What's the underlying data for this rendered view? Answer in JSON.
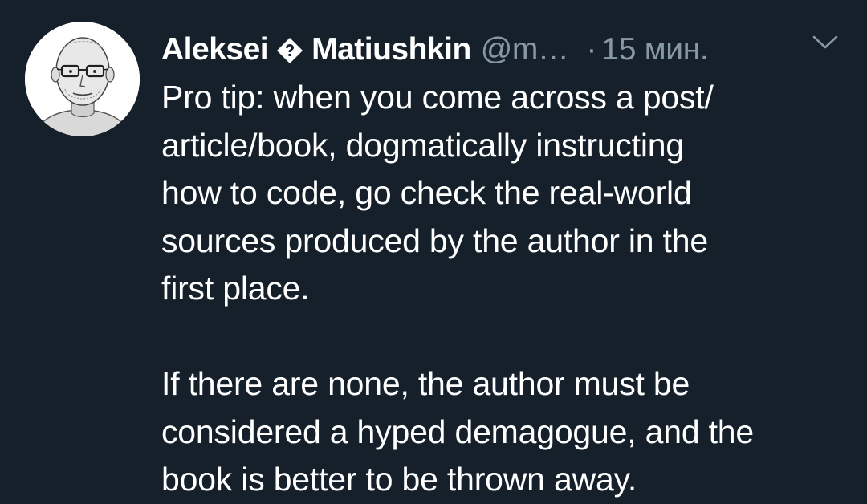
{
  "tweet": {
    "author_name_first": "Aleksei",
    "author_name_last": "Matiushkin",
    "handle": "@m…",
    "separator": "·",
    "timestamp": "15 мин.",
    "badge_icon": "verified-diamond-icon",
    "menu_icon": "chevron-down-icon",
    "text_lines": [
      "Pro tip: when you come across a post/",
      "article/book, dogmatically instructing",
      "how to code, go check the real-world",
      "sources produced by the author in the",
      "first place."
    ],
    "text_lines_2": [
      "If there are none, the author must be",
      "considered a hyped demagogue, and the",
      "book is better to be thrown away."
    ]
  },
  "colors": {
    "background": "#15202b",
    "primary_text": "#ffffff",
    "secondary_text": "#8899a6"
  }
}
